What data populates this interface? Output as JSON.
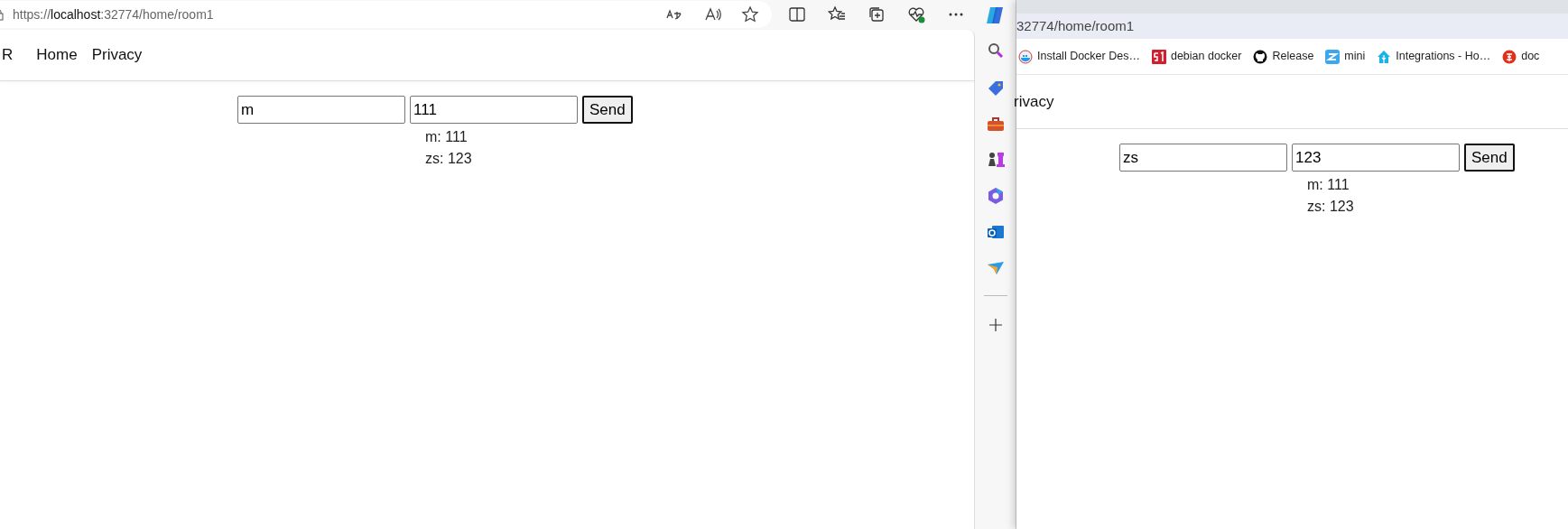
{
  "left_window": {
    "address_bar": {
      "url": "https://**localhost**:32774/home/room1"
    },
    "navbar": {
      "brand": "R",
      "links": [
        {
          "label": "Home"
        },
        {
          "label": "Privacy"
        }
      ]
    },
    "form": {
      "user_value": "m",
      "message_value": "111",
      "button": "Send"
    },
    "messages": [
      "m: 111",
      "zs: 123"
    ]
  },
  "right_window": {
    "address_bar": {
      "url": "32774/home/room1"
    },
    "bookmarks": [
      {
        "label": "Install Docker Des…",
        "kind": "docker"
      },
      {
        "label": "debian docker",
        "kind": "fiftyone"
      },
      {
        "label": "Release",
        "kind": "github"
      },
      {
        "label": "mini",
        "kind": "zblue"
      },
      {
        "label": "Integrations - Ho…",
        "kind": "house"
      },
      {
        "label": "doc",
        "kind": "redcircle"
      }
    ],
    "navbar": {
      "links": [
        {
          "label": "rivacy"
        }
      ]
    },
    "form": {
      "user_value": "zs",
      "message_value": "123",
      "button": "Send"
    },
    "messages": [
      "m: 111",
      "zs: 123"
    ]
  }
}
